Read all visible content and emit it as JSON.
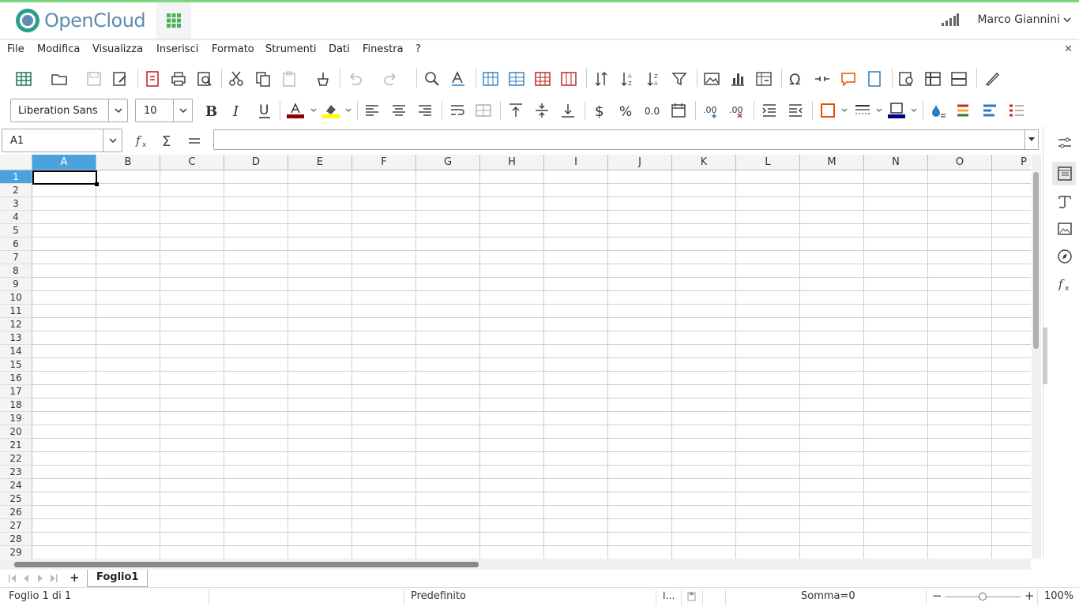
{
  "app": {
    "brand": "OpenCloud",
    "user_name": "Marco Giannini"
  },
  "menu": [
    "File",
    "Modifica",
    "Visualizza",
    "Inserisci",
    "Formato",
    "Strumenti",
    "Dati",
    "Finestra",
    "?"
  ],
  "toolbar": {
    "font_name": "Liberation Sans",
    "font_size": "10",
    "font_color": "#8b0000",
    "highlight_color": "#ffff00",
    "border_color": "#00008b"
  },
  "formula_bar": {
    "name_box": "A1",
    "content": ""
  },
  "grid": {
    "columns": [
      "A",
      "B",
      "C",
      "D",
      "E",
      "F",
      "G",
      "H",
      "I",
      "J",
      "K",
      "L",
      "M",
      "N",
      "O",
      "P"
    ],
    "rows": [
      "1",
      "2",
      "3",
      "4",
      "5",
      "6",
      "7",
      "8",
      "9",
      "10",
      "11",
      "12",
      "13",
      "14",
      "15",
      "16",
      "17",
      "18",
      "19",
      "20",
      "21",
      "22",
      "23",
      "24",
      "25",
      "26",
      "27",
      "28",
      "29"
    ],
    "selected_cell": "A1"
  },
  "sheets": [
    "Foglio1"
  ],
  "status": {
    "sheet_info": "Foglio 1 di 1",
    "page_style": "Predefinito",
    "sum": "Somma=0",
    "zoom": "100%",
    "zoom_level": 100
  }
}
